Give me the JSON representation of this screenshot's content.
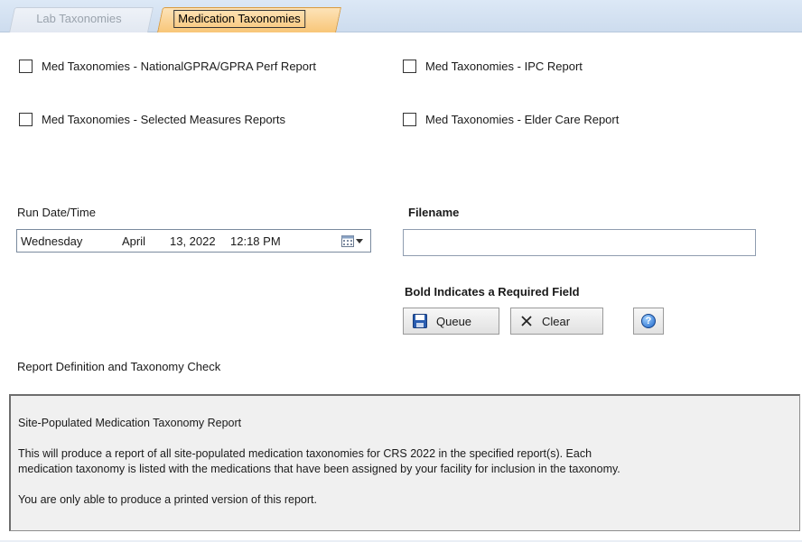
{
  "tabs": {
    "lab": "Lab Taxonomies",
    "med": "Medication Taxonomies"
  },
  "reports": {
    "national_gpra": "Med Taxonomies - NationalGPRA/GPRA Perf Report",
    "ipc": "Med Taxonomies - IPC Report",
    "selected_measures": "Med Taxonomies - Selected Measures Reports",
    "elder_care": "Med Taxonomies - Elder Care Report"
  },
  "run_date": {
    "label": "Run Date/Time",
    "weekday": "Wednesday",
    "month": "April",
    "day_year": "13, 2022",
    "time": "12:18 PM"
  },
  "filename": {
    "label": "Filename",
    "value": ""
  },
  "required_note": "Bold Indicates a Required Field",
  "buttons": {
    "queue": "Queue",
    "clear": "Clear",
    "help_glyph": "?"
  },
  "report_definition": {
    "heading": "Report Definition and Taxonomy Check",
    "title": "Site-Populated Medication Taxonomy Report",
    "body_line1": "This will produce a report of all site-populated medication taxonomies for CRS 2022 in the specified report(s).  Each",
    "body_line2": "medication taxonomy is listed with the medications that have been assigned by your facility for inclusion in the taxonomy.",
    "printed_note": "You are only able to produce a printed version of this report."
  },
  "icons": {
    "calendar": "calendar-icon",
    "save": "floppy-disk-icon",
    "clear": "x-icon",
    "help": "help-icon"
  }
}
